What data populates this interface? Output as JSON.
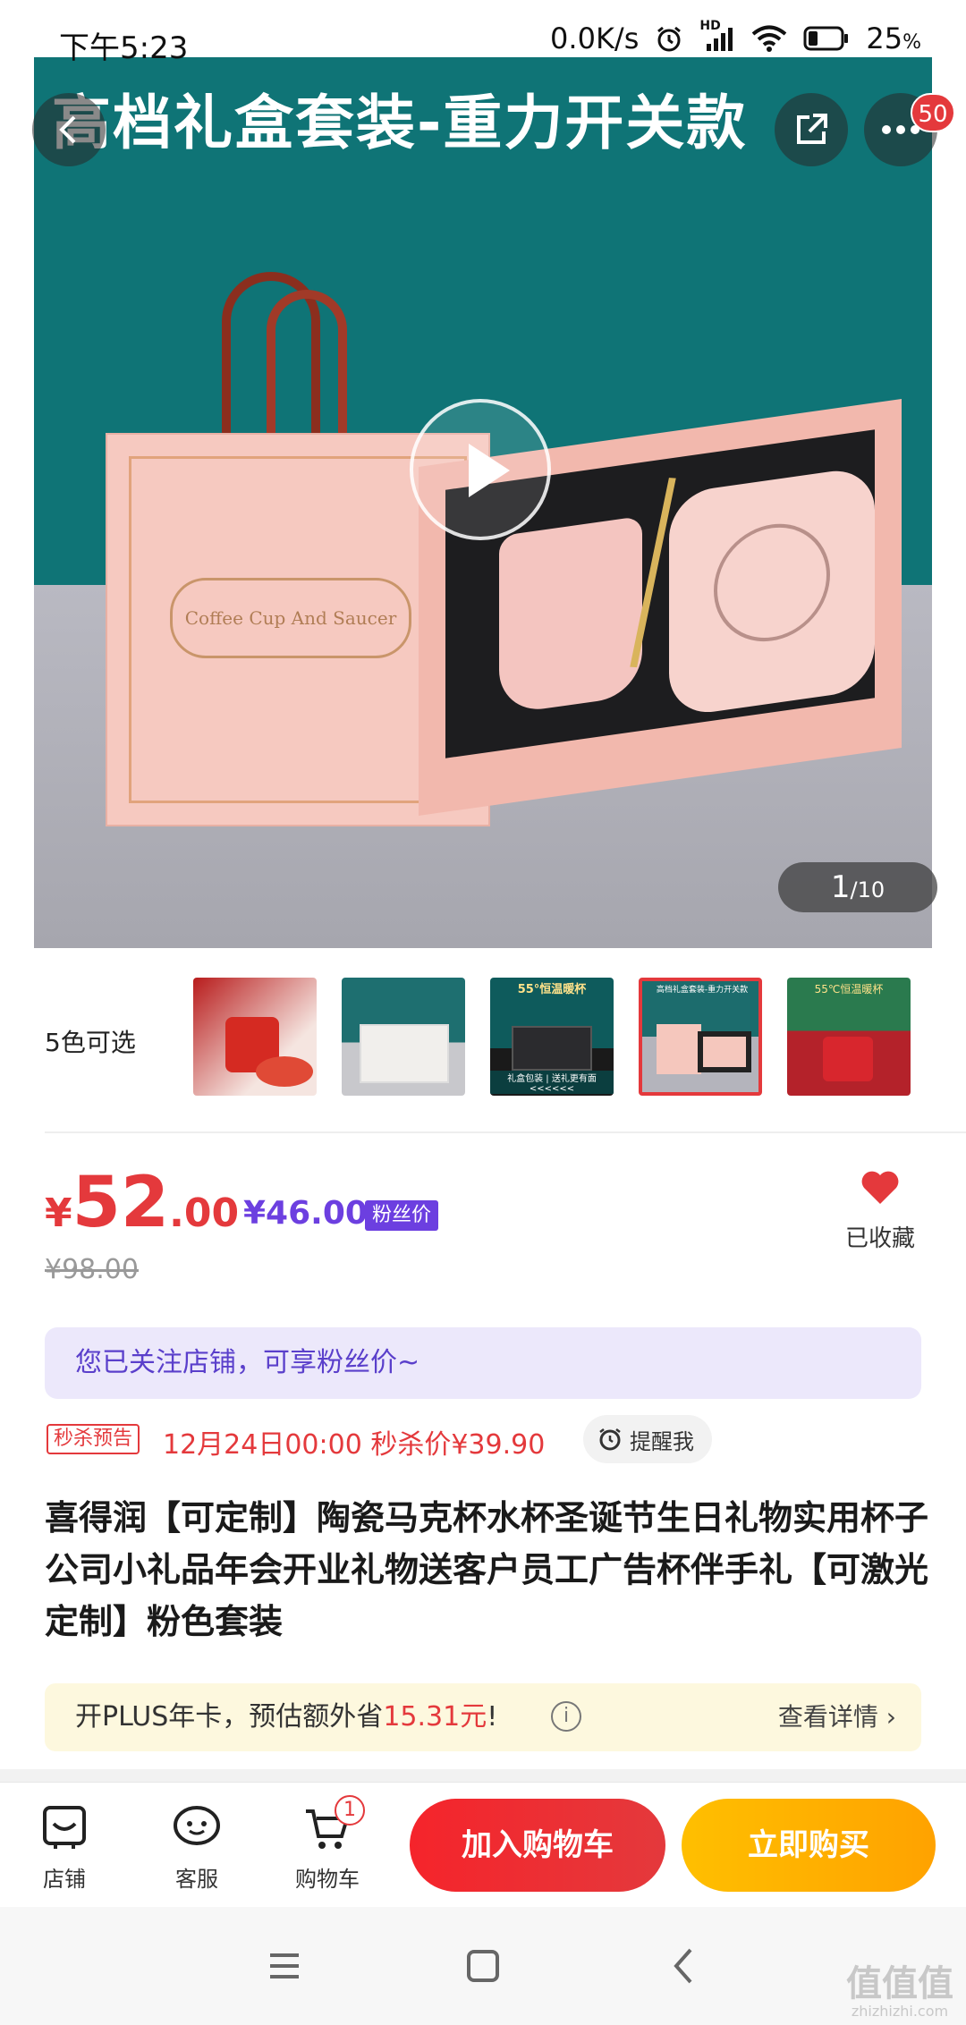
{
  "status_bar": {
    "time": "下午5:23",
    "net_speed": "0.0K/s",
    "network": "HD",
    "battery": "25",
    "battery_unit": "%"
  },
  "gallery": {
    "banner_text": "高档礼盒套装-重力开关款",
    "bag_label": "Coffee Cup And Saucer",
    "current": "1",
    "total": "/10",
    "more_badge": "50",
    "back_icon": "chevron-left-icon",
    "share_icon": "share-icon",
    "more_icon": "more-dots-icon"
  },
  "colors": {
    "label": "5色可选",
    "selected_index": 3,
    "thumbnails": [
      {
        "caption": "",
        "bg": "#c8261e"
      },
      {
        "caption": "",
        "bg": "#1e6f70"
      },
      {
        "caption": "55°恒温暖杯",
        "bg": "#0e5b5c"
      },
      {
        "caption": "高档礼盒套装-重力开关款",
        "bg": "#1c6c6d"
      },
      {
        "caption": "55℃恒温暖杯",
        "bg": "#2a7a4e"
      }
    ],
    "thumb_extra": [
      "",
      "",
      "礼盒包装 | 送礼更有面 <<<<<<",
      "",
      ""
    ]
  },
  "price": {
    "currency": "¥",
    "integer": "52",
    "decimal": ".00",
    "fan_price": "¥46.00",
    "fan_tag": "粉丝价",
    "original": "¥98.00",
    "favorite_label": "已收藏"
  },
  "notice": "您已关注店铺，可享粉丝价~",
  "seckill": {
    "tag": "秒杀预告",
    "text": "12月24日00:00 秒杀价¥39.90",
    "remind_label": "提醒我"
  },
  "title": "喜得润【可定制】陶瓷马克杯水杯圣诞节生日礼物实用杯子公司小礼品年会开业礼物送客户员工广告杯伴手礼【可激光定制】粉色套装",
  "plus": {
    "text_prefix": "开PLUS年卡，预估额外省",
    "save_amount": "15.31元",
    "text_suffix": "!",
    "info": "i",
    "detail": "查看详情 ›"
  },
  "actions": {
    "shop": "店铺",
    "service": "客服",
    "cart": "购物车",
    "cart_badge": "1",
    "add_to_cart": "加入购物车",
    "buy_now": "立即购买"
  },
  "watermark": {
    "text": "值值值",
    "sub": "zhizhizhi.com"
  },
  "colors_theme": {
    "primary_red": "#e4393c",
    "fan_purple": "#6c3fe0",
    "buy_orange": "#ffa200"
  }
}
